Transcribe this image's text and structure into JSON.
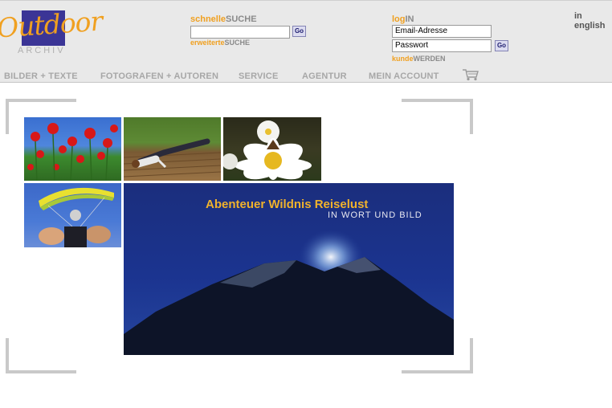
{
  "logo": {
    "script": "Outdoor",
    "sub": "ARCHIV"
  },
  "quick_search": {
    "label_prefix": "schnelle",
    "label_main": "SUCHE",
    "input_value": "",
    "go": "Go",
    "extended_prefix": "erweiterte",
    "extended_main": "SUCHE"
  },
  "login": {
    "label_prefix": "log",
    "label_main": "IN",
    "email_placeholder": "Email-Adresse",
    "password_placeholder": "Passwort",
    "go": "Go",
    "register_prefix": "kunde",
    "register_main": "WERDEN"
  },
  "language_link": "in english",
  "nav": {
    "items": [
      {
        "label": "BILDER + TEXTE"
      },
      {
        "label": "FOTOGRAFEN + AUTOREN"
      },
      {
        "label": "SERVICE"
      },
      {
        "label": "AGENTUR"
      },
      {
        "label": "MEIN ACCOUNT"
      }
    ],
    "cart_icon": "shopping-cart-icon"
  },
  "photos": [
    {
      "subject": "poppies-field"
    },
    {
      "subject": "person-lying-on-deck"
    },
    {
      "subject": "butterfly-on-daisy"
    },
    {
      "subject": "paraglider-feet"
    }
  ],
  "banner": {
    "title": "Abenteuer Wildnis Reiselust",
    "subtitle": "IN WORT UND BILD"
  },
  "colors": {
    "accent": "#f0a020",
    "brand": "#3b3596",
    "nav_text": "#a7a7a7",
    "header_bg": "#e9e9e9"
  }
}
